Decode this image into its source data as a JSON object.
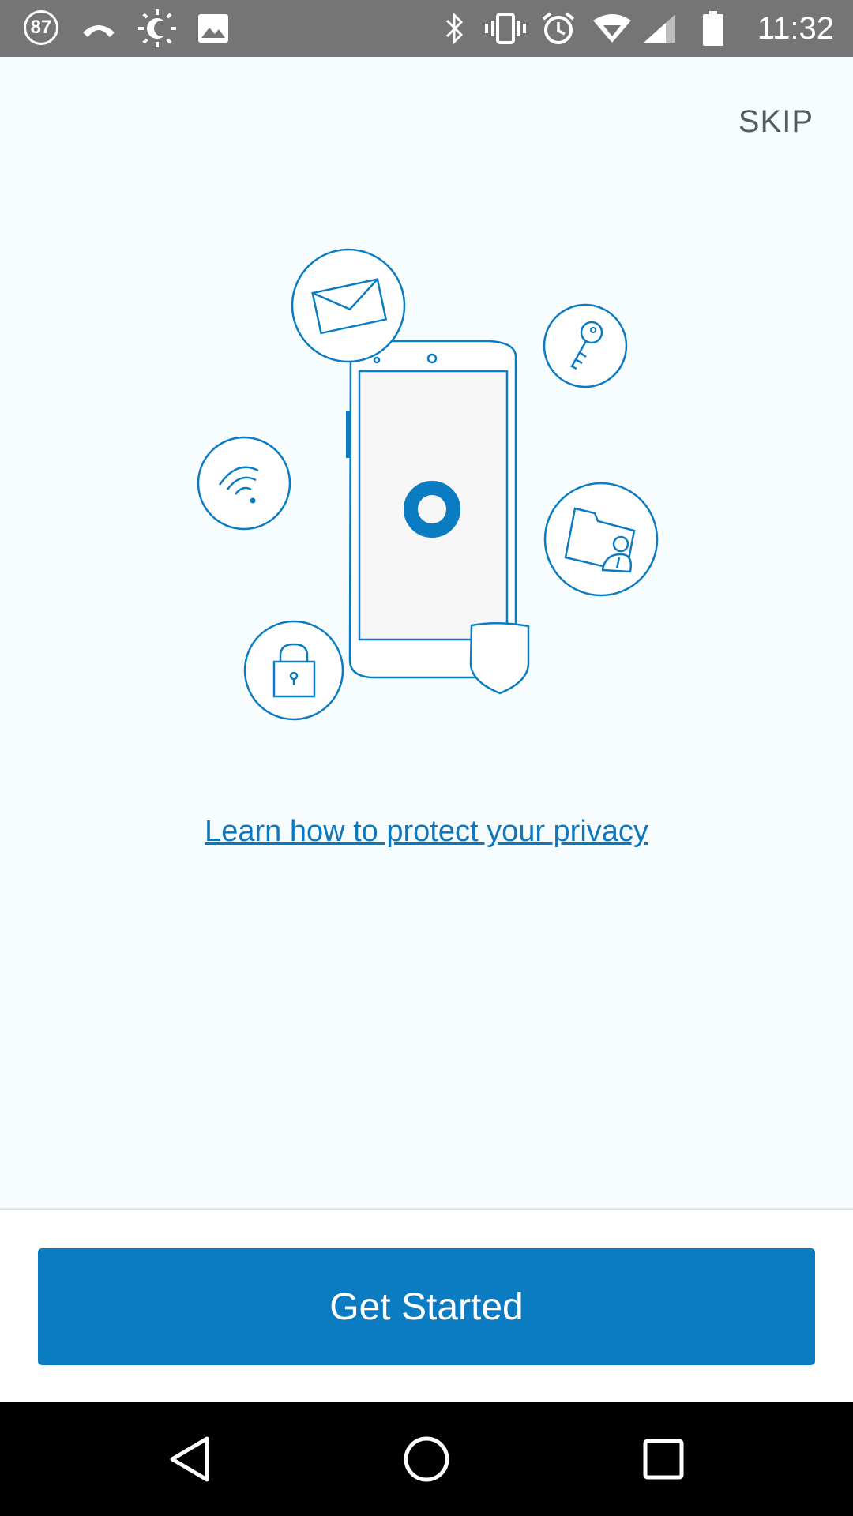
{
  "status_bar": {
    "notification_count": "87",
    "time": "11:32",
    "icons": [
      "notification-count-icon",
      "missed-call-icon",
      "brightness-icon",
      "image-icon",
      "bluetooth-icon",
      "vibrate-icon",
      "alarm-icon",
      "wifi-icon",
      "cell-signal-icon",
      "battery-icon"
    ]
  },
  "header": {
    "skip_label": "SKIP"
  },
  "illustration": {
    "icons": [
      "envelope-icon",
      "key-icon",
      "wifi-icon",
      "folder-user-icon",
      "lock-icon",
      "phone-icon",
      "shield-icon"
    ]
  },
  "main": {
    "learn_link": "Learn how to protect your privacy"
  },
  "footer": {
    "get_started_label": "Get Started"
  },
  "nav_bar": {
    "icons": [
      "back-icon",
      "home-icon",
      "recents-icon"
    ]
  },
  "colors": {
    "accent": "#0b7cc1",
    "background": "#f7fcfe",
    "status_bar": "#757575"
  }
}
